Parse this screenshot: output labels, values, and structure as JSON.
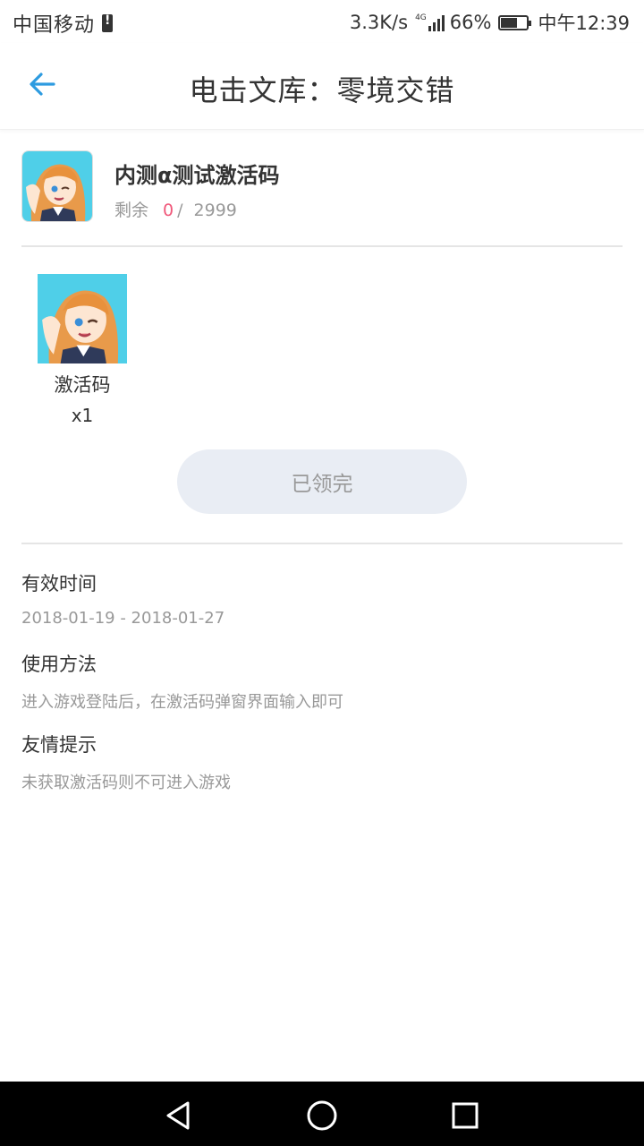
{
  "status_bar": {
    "carrier": "中国移动",
    "net_speed": "3.3K/s",
    "network_type": "4G",
    "battery_percent": "66%",
    "battery_level": 0.66,
    "time": "中午12:39"
  },
  "header": {
    "back_icon": "arrow-left-icon",
    "title": "电击文库：零境交错"
  },
  "gift": {
    "name": "内测α测试激活码",
    "remaining_label": "剩余",
    "remaining_count": "0",
    "separator": "/",
    "total": "2999"
  },
  "reward": {
    "name": "激活码",
    "quantity": "x1"
  },
  "claim_button": {
    "label": "已领完"
  },
  "sections": [
    {
      "title": "有效时间",
      "value": "2018-01-19 - 2018-01-27"
    },
    {
      "title": "使用方法",
      "value": "进入游戏登陆后，在激活码弹窗界面输入即可"
    },
    {
      "title": "友情提示",
      "value": "未获取激活码则不可进入游戏"
    }
  ],
  "nav_bar": {
    "back_icon": "triangle-back-icon",
    "home_icon": "circle-home-icon",
    "recents_icon": "square-recents-icon"
  },
  "colors": {
    "accent": "#2d9be0",
    "remaining": "#f0587a",
    "button_bg": "#e9edf4"
  }
}
